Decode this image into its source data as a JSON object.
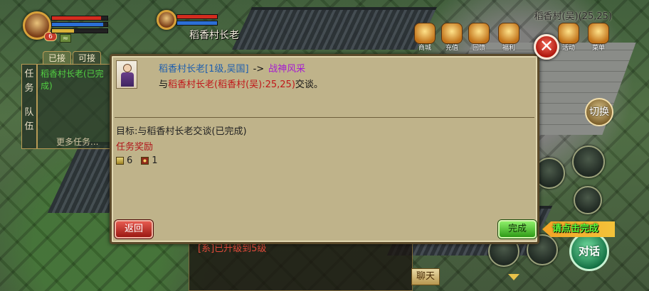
{
  "player": {
    "level": "6",
    "tab_hide": "≈"
  },
  "target": {
    "name": "稻香村长老"
  },
  "map": {
    "location": "稻香村(吴)(25,25)"
  },
  "quest_panel": {
    "tabs": [
      {
        "label": "已接"
      },
      {
        "label": "可接"
      }
    ],
    "side_label": "任务",
    "side_label2": "队伍",
    "items": [
      {
        "label": "稻香村长老(已完成)"
      }
    ],
    "more": "更多任务..."
  },
  "top_icons": [
    {
      "label": "商城"
    },
    {
      "label": "充值"
    },
    {
      "label": "回馈"
    },
    {
      "label": "福利"
    },
    {
      "label": "活动"
    },
    {
      "label": "菜单"
    }
  ],
  "dialog": {
    "npc_info": "稻香村长老[1级,吴国]",
    "arrow": "->",
    "quest_name": "战神风采",
    "line2_prefix": "与",
    "line2_npc": "稻香村长老(稻香村(吴):25,25)",
    "line2_suffix": "交谈。",
    "goal": "目标:与稻香村长老交谈(已完成)",
    "reward_title": "任务奖励",
    "reward_exp": "6",
    "reward_coin": "1",
    "back_label": "返回",
    "done_label": "完成"
  },
  "hud": {
    "switch_label": "切换",
    "hint_prefix": "请点击",
    "hint_action": "完成",
    "talk_label": "对话",
    "chat_label": "聊天",
    "chat_line": "[系]已升级到5级"
  },
  "colors": {
    "quest_src": "#1f5fae",
    "quest_dst": "#a51bd1",
    "highlight_red": "#c0181a",
    "done_green": "#2e9a16"
  }
}
